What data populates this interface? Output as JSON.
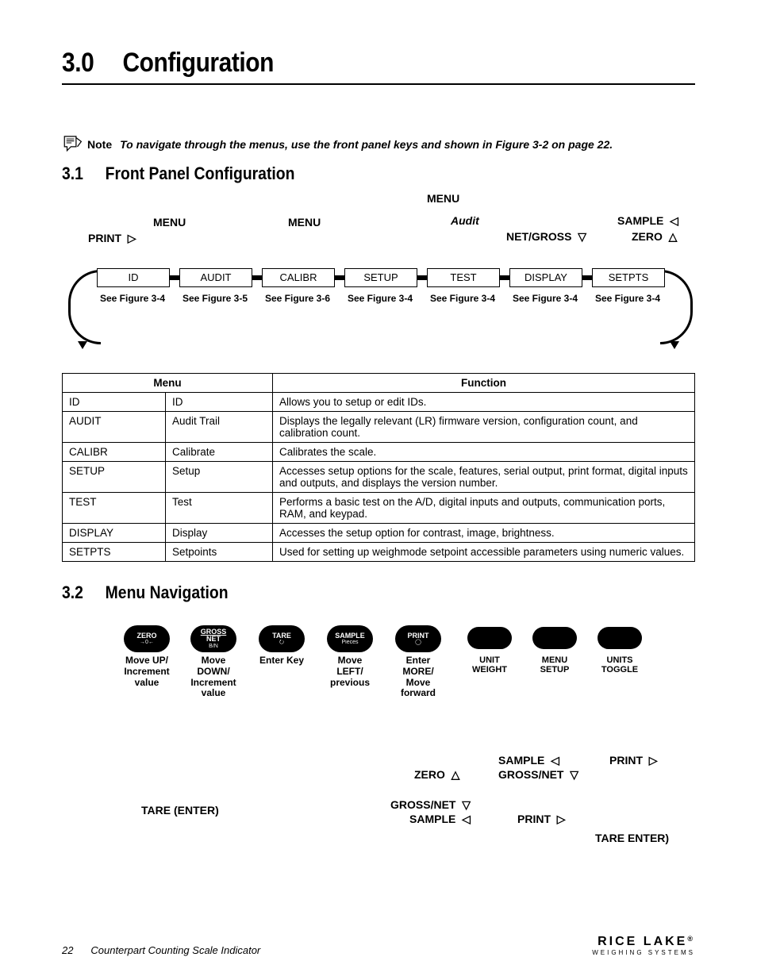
{
  "heading": {
    "number": "3.0",
    "title": "Configuration"
  },
  "note": {
    "label": "Note",
    "text": "To navigate through the menus, use the front panel keys and shown in Figure 3-2 on page 22."
  },
  "section31": {
    "number": "3.1",
    "title": "Front Panel Configuration"
  },
  "flow": {
    "top_menu": "MENU",
    "labels": {
      "menu1": "MENU",
      "menu2": "MENU",
      "audit": "Audit",
      "sample": "SAMPLE",
      "print": "PRINT",
      "netgross": "NET/GROSS",
      "zero": "ZERO"
    },
    "boxes": [
      "ID",
      "AUDIT",
      "CALIBR",
      "SETUP",
      "TEST",
      "DISPLAY",
      "SETPTS"
    ],
    "see": [
      "See Figure 3-4",
      "See Figure 3-5",
      "See Figure 3-6",
      "See Figure 3-4",
      "See Figure 3-4",
      "See Figure 3-4",
      "See Figure 3-4"
    ]
  },
  "table": {
    "headers": [
      "Menu",
      "Function"
    ],
    "rows": [
      {
        "c1": "ID",
        "c2": "ID",
        "c3": "Allows you to setup or edit IDs."
      },
      {
        "c1": "AUDIT",
        "c2": "Audit Trail",
        "c3": "Displays the legally relevant (LR) firmware version, configuration count, and calibration count."
      },
      {
        "c1": "CALIBR",
        "c2": "Calibrate",
        "c3": "Calibrates the scale."
      },
      {
        "c1": "SETUP",
        "c2": "Setup",
        "c3": "Accesses setup options for the scale, features, serial output, print format, digital inputs and outputs, and displays the version number."
      },
      {
        "c1": "TEST",
        "c2": "Test",
        "c3": "Performs a basic test on the A/D, digital inputs and outputs, communication ports, RAM, and keypad."
      },
      {
        "c1": "DISPLAY",
        "c2": "Display",
        "c3": "Accesses the setup option for contrast, image, brightness."
      },
      {
        "c1": "SETPTS",
        "c2": "Setpoints",
        "c3": "Used for setting up weighmode setpoint accessible parameters using numeric values."
      }
    ]
  },
  "section32": {
    "number": "3.2",
    "title": "Menu Navigation"
  },
  "keys": {
    "zero": {
      "line1": "ZERO",
      "line2": "→0←",
      "desc": "Move UP/\nIncrement\nvalue"
    },
    "gross": {
      "line1": "GROSS",
      "line2": "NET",
      "line3": "B/N",
      "desc": "Move\nDOWN/\nIncrement\nvalue"
    },
    "tare": {
      "line1": "TARE",
      "line2": "⭮",
      "desc": "Enter Key"
    },
    "sample": {
      "line1": "SAMPLE",
      "line2": "Pieces",
      "desc": "Move\nLEFT/\nprevious"
    },
    "print": {
      "line1": "PRINT",
      "line2": "◯",
      "desc": "Enter\nMORE/\nMove\nforward"
    },
    "unit": {
      "label": "UNIT\nWEIGHT"
    },
    "menu": {
      "label": "MENU\nSETUP"
    },
    "units": {
      "label": "UNITS\nTOGGLE"
    }
  },
  "navlabels": {
    "tare_enter": "TARE (ENTER)",
    "zero_up": "ZERO",
    "grossnet_down": "GROSS/NET",
    "sample_left": "SAMPLE",
    "print_right": "PRINT",
    "sample_left2": "SAMPLE",
    "grossnet_down2": "GROSS/NET",
    "print_right2": "PRINT",
    "tare_enter2": "TARE  ENTER)"
  },
  "footer": {
    "page": "22",
    "doc": "Counterpart Counting Scale Indicator",
    "brand": "RICE LAKE",
    "brand_sub": "WEIGHING SYSTEMS"
  }
}
